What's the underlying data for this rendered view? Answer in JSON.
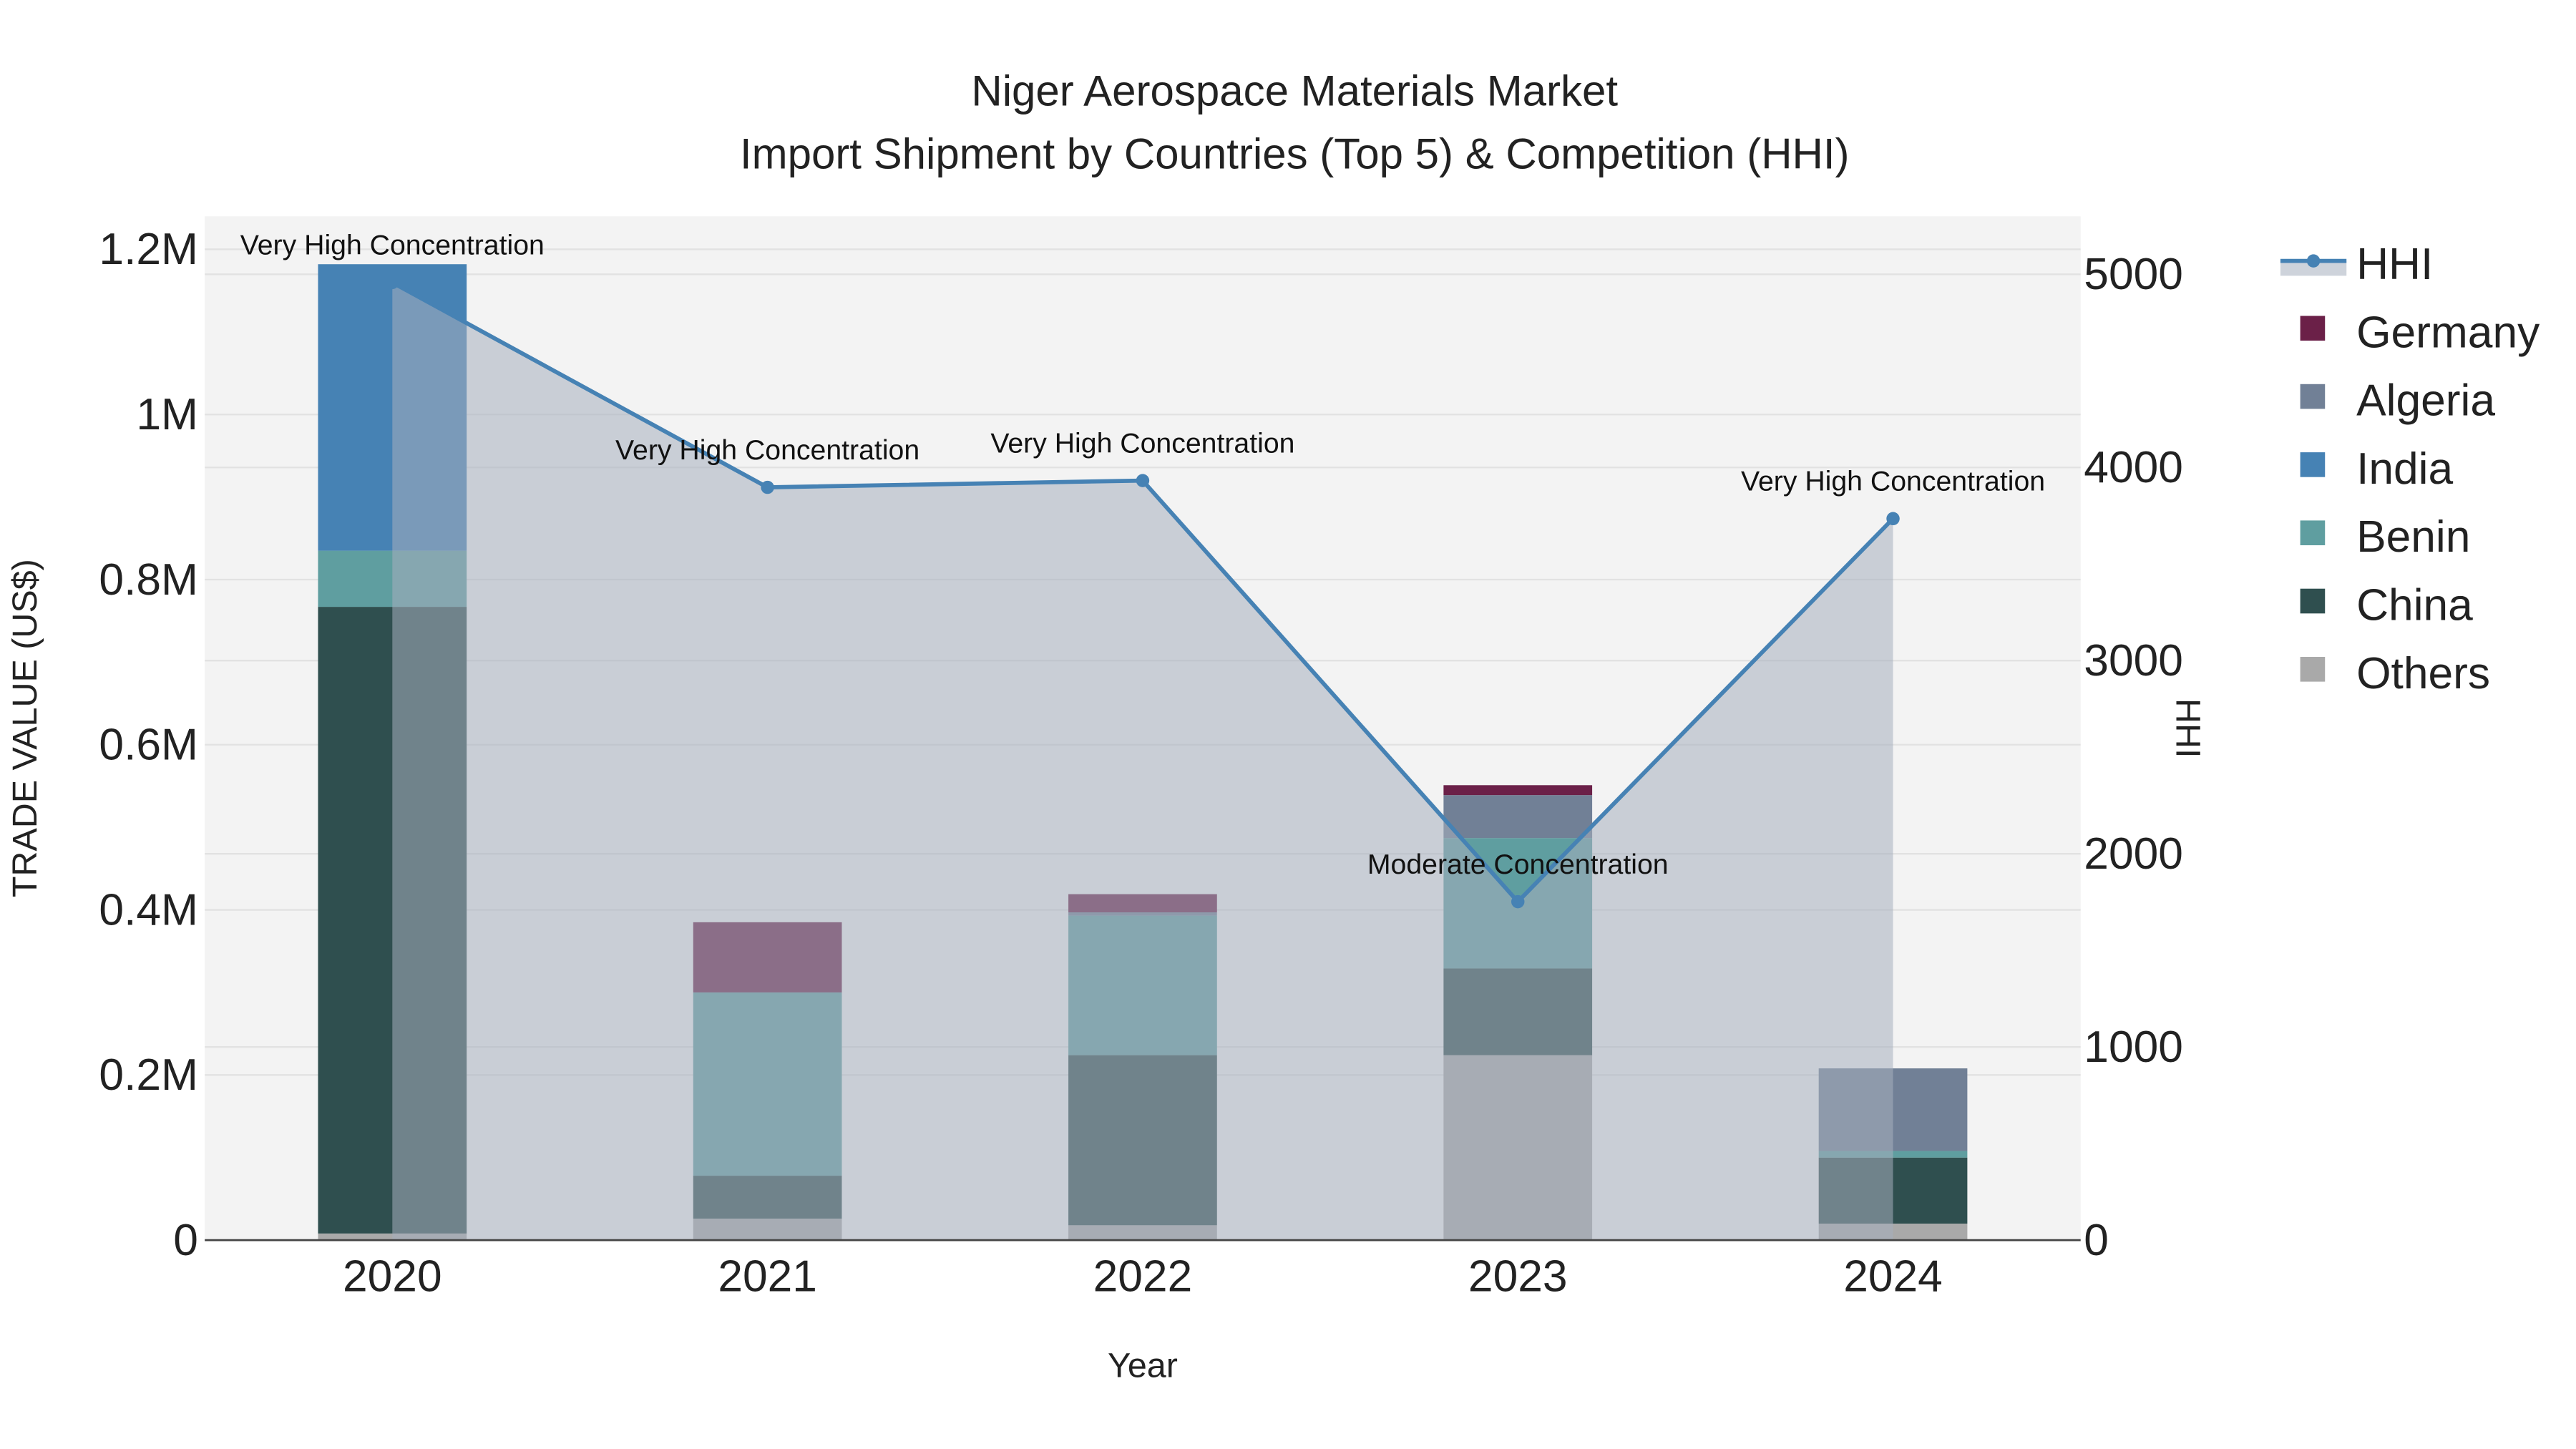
{
  "chart_data": {
    "type": "bar",
    "title": "Niger Aerospace Materials Market",
    "subtitle": "Import Shipment by Countries (Top 5) & Competition (HHI)",
    "xlabel": "Year",
    "ylabel": "TRADE VALUE (US$)",
    "y2label": "HHI",
    "categories": [
      "2020",
      "2021",
      "2022",
      "2023",
      "2024"
    ],
    "ylim": [
      0,
      1240000
    ],
    "y2lim": [
      0,
      5300
    ],
    "yticks": [
      0,
      200000,
      400000,
      600000,
      800000,
      1000000,
      1200000
    ],
    "ytick_labels": [
      "0",
      "0.2M",
      "0.4M",
      "0.6M",
      "0.8M",
      "1M",
      "1.2M"
    ],
    "y2ticks": [
      0,
      1000,
      2000,
      3000,
      4000,
      5000
    ],
    "y2tick_labels": [
      "0",
      "1000",
      "2000",
      "3000",
      "4000",
      "5000"
    ],
    "grid": true,
    "legend_position": "right",
    "stack_order": [
      "Others",
      "China",
      "Benin",
      "India",
      "Algeria",
      "Germany"
    ],
    "series": [
      {
        "name": "Germany",
        "color": "#6b2048",
        "values": [
          0,
          85000,
          22000,
          12000,
          0
        ]
      },
      {
        "name": "Algeria",
        "color": "#718096",
        "values": [
          0,
          0,
          4000,
          52000,
          100000
        ]
      },
      {
        "name": "India",
        "color": "#4682b4",
        "values": [
          347000,
          0,
          0,
          0,
          0
        ]
      },
      {
        "name": "Benin",
        "color": "#5f9ea0",
        "values": [
          68000,
          222000,
          169000,
          158000,
          8000
        ]
      },
      {
        "name": "China",
        "color": "#2f4f4f",
        "values": [
          759000,
          52000,
          206000,
          105000,
          80000
        ]
      },
      {
        "name": "Others",
        "color": "#a9a9a9",
        "values": [
          8000,
          26000,
          18000,
          224000,
          20000
        ]
      }
    ],
    "hhi": {
      "name": "HHI",
      "color": "#4682b4",
      "values": [
        4957,
        3897,
        3932,
        1752,
        3735
      ],
      "annotations": [
        "Very High Concentration",
        "Very High Concentration",
        "Very High Concentration",
        "Moderate Concentration",
        "Very High Concentration"
      ]
    },
    "legend": [
      "HHI",
      "Germany",
      "Algeria",
      "India",
      "Benin",
      "China",
      "Others"
    ]
  }
}
